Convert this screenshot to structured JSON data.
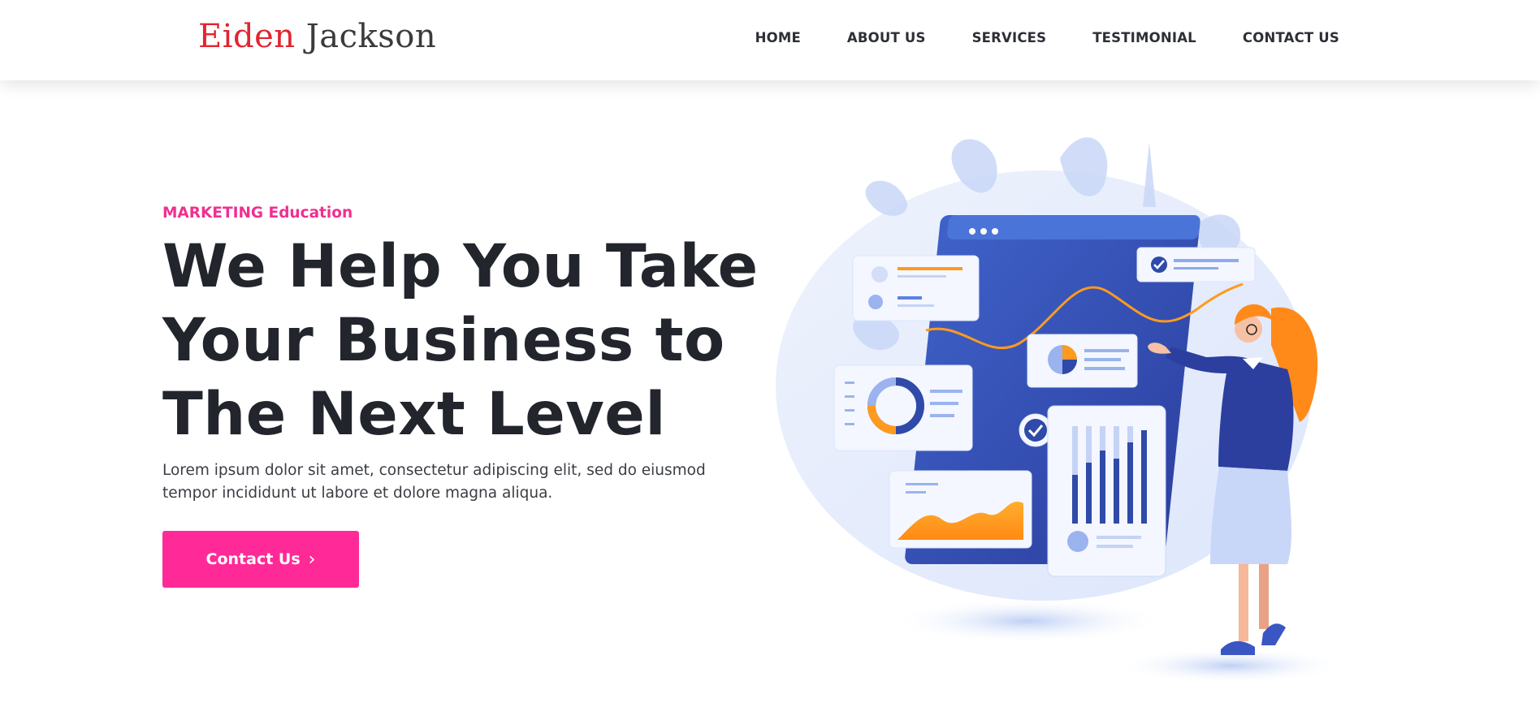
{
  "header": {
    "logo_first": "Eiden",
    "logo_last": "Jackson",
    "nav": [
      "HOME",
      "ABOUT US",
      "SERVICES",
      "TESTIMONIAL",
      "CONTACT US"
    ]
  },
  "hero": {
    "eyebrow": "MARKETING Education",
    "headline": [
      "We Help You Take",
      "Your Business to",
      "The Next Level"
    ],
    "description": "Lorem ipsum dolor sit amet, consectetur adipiscing elit, sed do eiusmod tempor incididunt ut labore et dolore magna aliqua.",
    "cta_label": "Contact Us",
    "cta_icon": "chevron-right-icon"
  },
  "colors": {
    "logo_red": "#e2242f",
    "accent_pink": "#ff2a97",
    "eyebrow_pink": "#f0308f",
    "illustration_blue": "#3550b8",
    "illustration_orange": "#ff9a1f"
  }
}
